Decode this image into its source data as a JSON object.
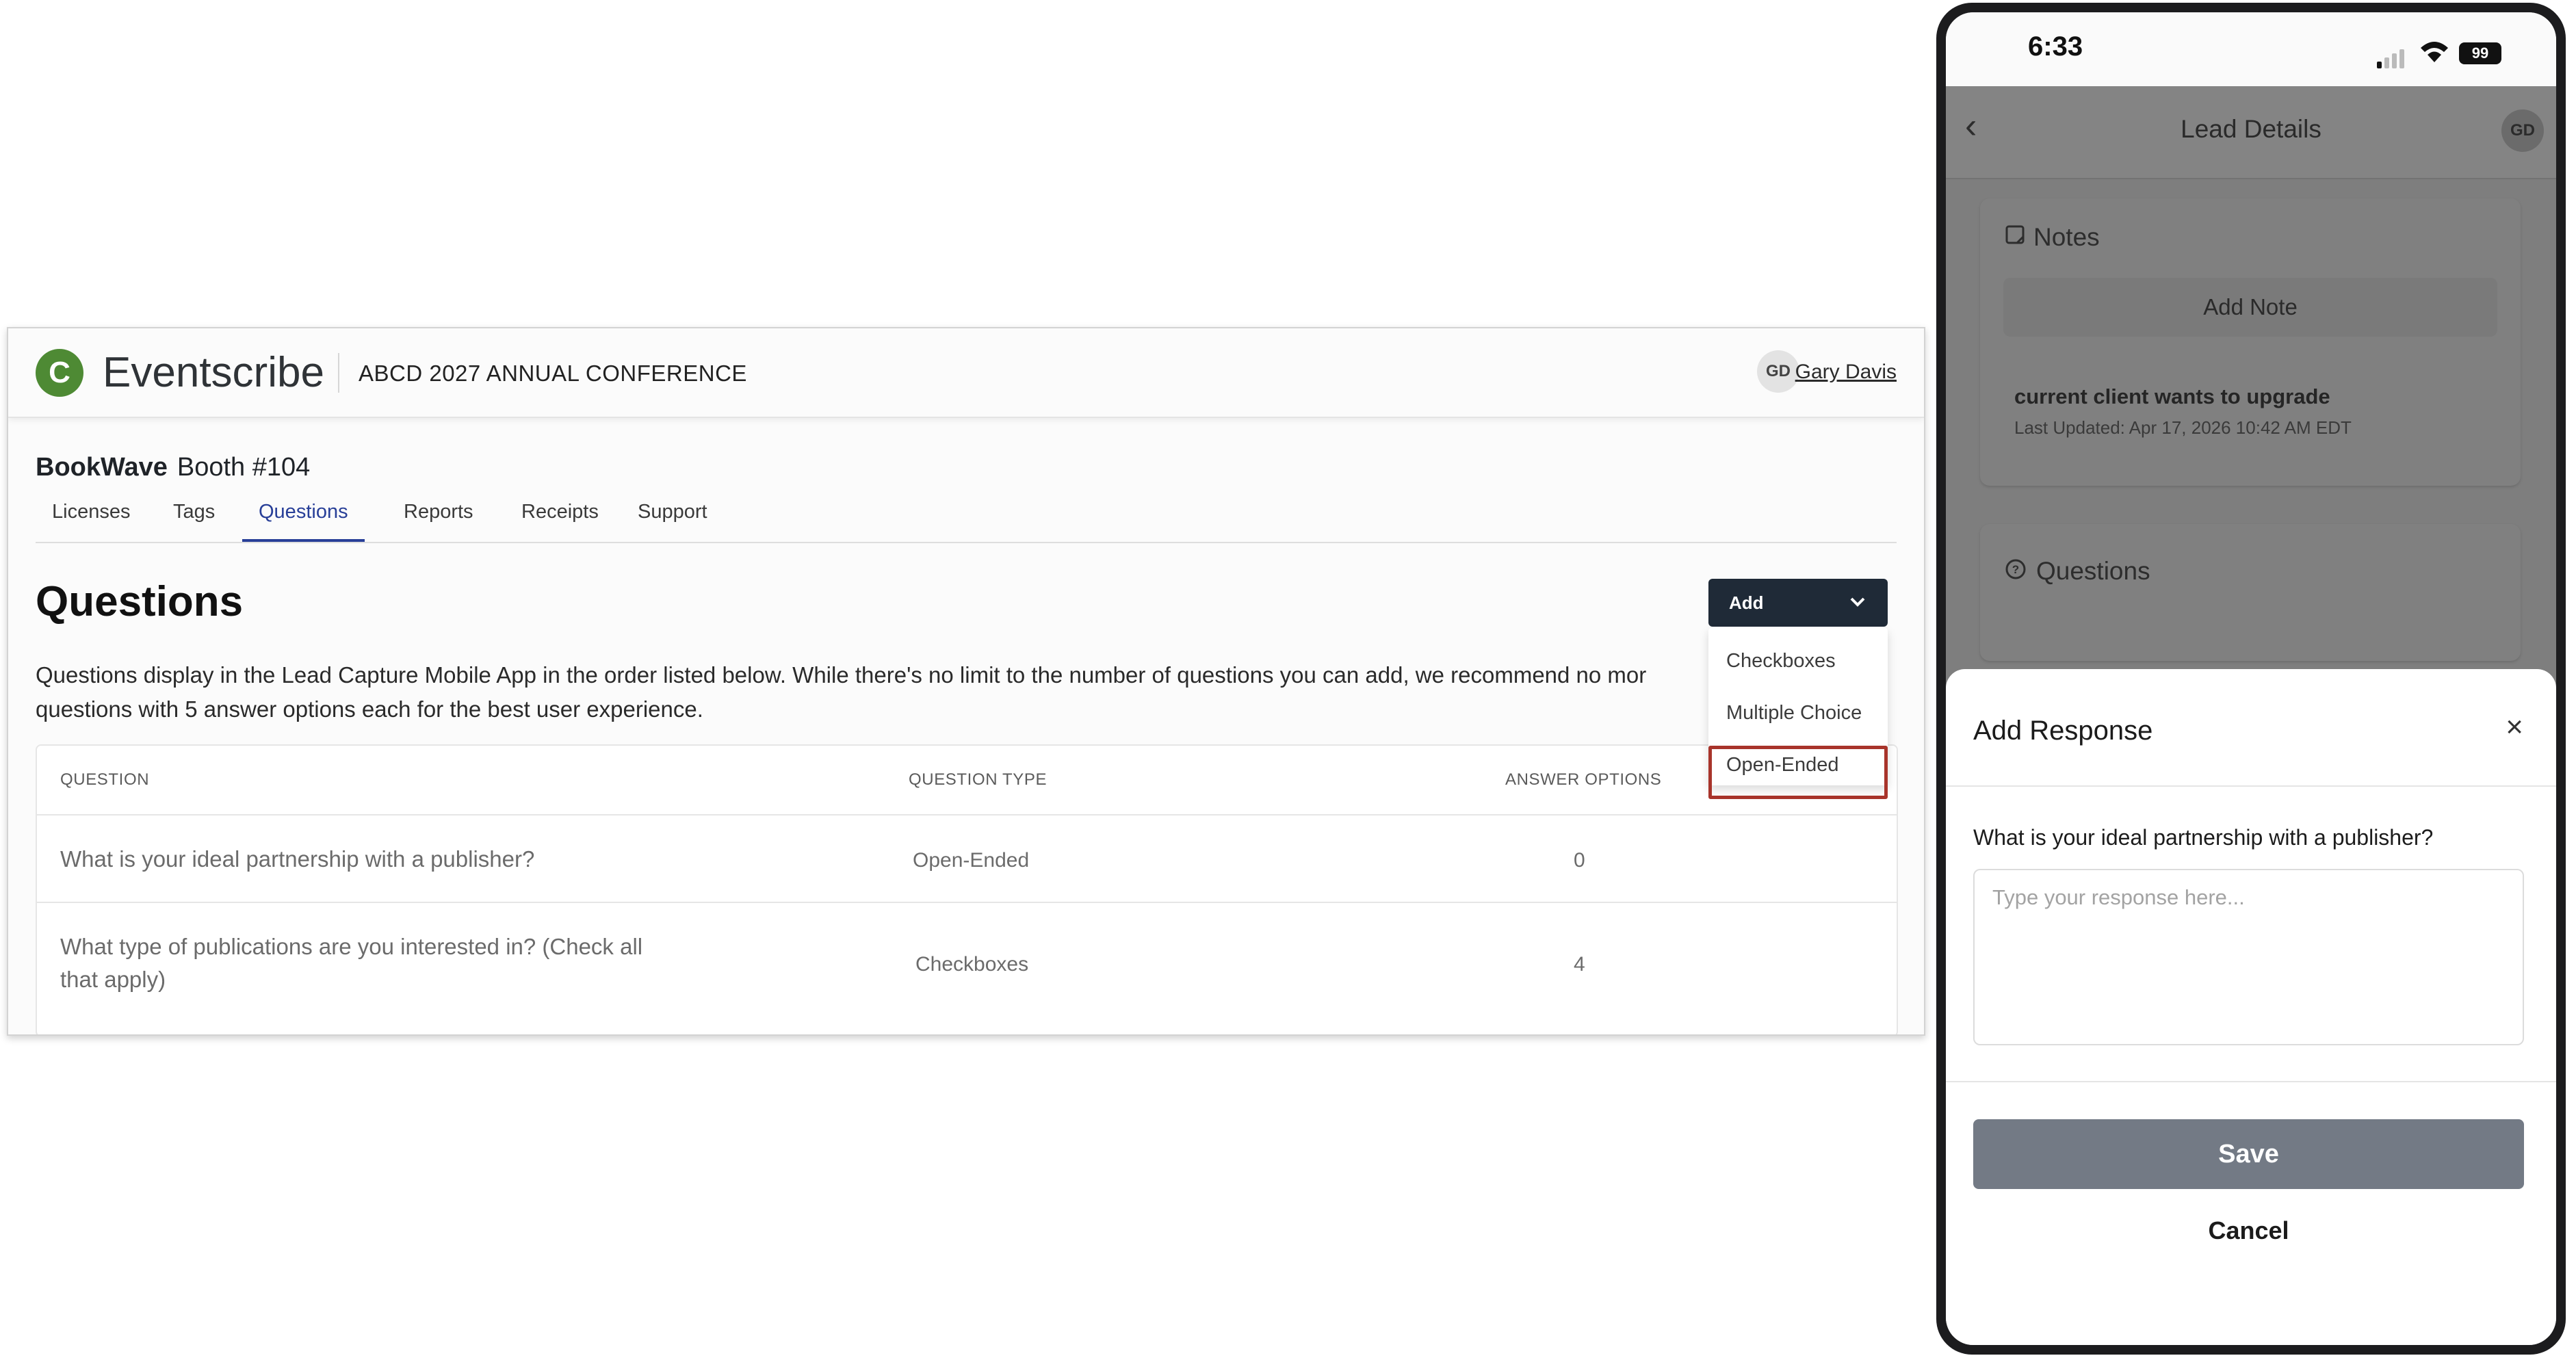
{
  "web": {
    "logo_letter": "C",
    "brand": "Eventscribe",
    "conference": "ABCD 2027 ANNUAL CONFERENCE",
    "user": {
      "initials": "GD",
      "name": "Gary Davis"
    },
    "booth": {
      "company": "BookWave",
      "label": "Booth #104"
    },
    "tabs": [
      {
        "label": "Licenses"
      },
      {
        "label": "Tags"
      },
      {
        "label": "Questions",
        "active": true
      },
      {
        "label": "Reports"
      },
      {
        "label": "Receipts"
      },
      {
        "label": "Support"
      }
    ],
    "page_title": "Questions",
    "add_button": "Add",
    "description": "Questions display in the Lead Capture Mobile App in the order listed below. While there's no limit to the number of questions you can add, we recommend no mor questions with 5 answer options each for the best user experience.",
    "dropdown": [
      "Checkboxes",
      "Multiple Choice",
      "Open-Ended"
    ],
    "table": {
      "headers": [
        "QUESTION",
        "QUESTION TYPE",
        "ANSWER OPTIONS"
      ],
      "rows": [
        {
          "question": "What is your ideal partnership with a publisher?",
          "type": "Open-Ended",
          "options": "0"
        },
        {
          "question": "What type of publications are you interested in? (Check all that apply)",
          "type": "Checkboxes",
          "options": "4"
        }
      ]
    }
  },
  "phone": {
    "time": "6:33",
    "battery": "99",
    "nav": {
      "back": "‹",
      "title": "Lead Details",
      "avatar": "GD"
    },
    "notes": {
      "title": "Notes",
      "add_note": "Add Note",
      "note": "current client wants to upgrade",
      "updated": "Last Updated: Apr 17, 2026 10:42 AM EDT"
    },
    "questions_title": "Questions",
    "sheet": {
      "title": "Add Response",
      "close": "×",
      "question": "What is your ideal partnership with a publisher?",
      "placeholder": "Type your response here...",
      "value": "",
      "save": "Save",
      "cancel": "Cancel"
    }
  },
  "colors": {
    "brand_green": "#4e8a34",
    "tab_active": "#283f98",
    "add_button": "#1f2a37",
    "highlight": "#a8342b",
    "save_button": "#737a85"
  }
}
